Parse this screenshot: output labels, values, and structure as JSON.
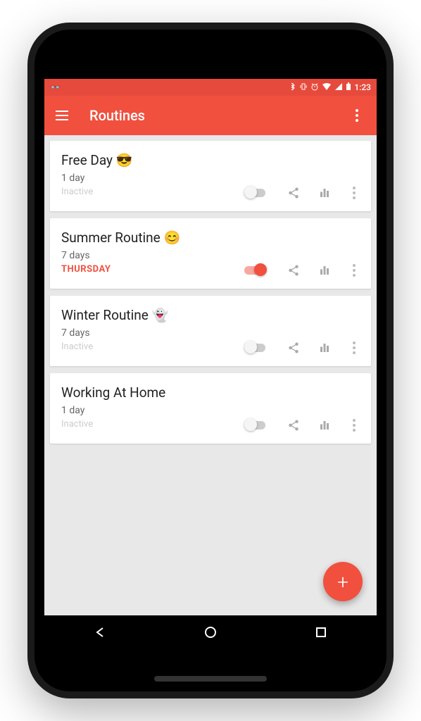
{
  "statusbar": {
    "time": "1:23"
  },
  "appbar": {
    "title": "Routines"
  },
  "routines": [
    {
      "title": "Free Day 😎",
      "sub": "1 day",
      "status": "Inactive",
      "active": false
    },
    {
      "title": "Summer Routine 😊",
      "sub": "7 days",
      "status": "THURSDAY",
      "active": true
    },
    {
      "title": "Winter Routine 👻",
      "sub": "7 days",
      "status": "Inactive",
      "active": false
    },
    {
      "title": "Working At Home",
      "sub": "1 day",
      "status": "Inactive",
      "active": false
    }
  ],
  "fab": {
    "label": "+"
  }
}
